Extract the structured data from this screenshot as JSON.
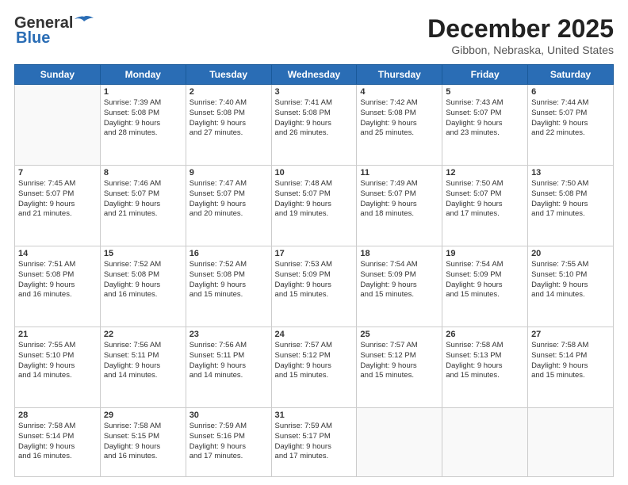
{
  "header": {
    "logo_line1": "General",
    "logo_line2": "Blue",
    "month_title": "December 2025",
    "location": "Gibbon, Nebraska, United States"
  },
  "weekdays": [
    "Sunday",
    "Monday",
    "Tuesday",
    "Wednesday",
    "Thursday",
    "Friday",
    "Saturday"
  ],
  "weeks": [
    [
      {
        "day": "",
        "info": ""
      },
      {
        "day": "1",
        "info": "Sunrise: 7:39 AM\nSunset: 5:08 PM\nDaylight: 9 hours\nand 28 minutes."
      },
      {
        "day": "2",
        "info": "Sunrise: 7:40 AM\nSunset: 5:08 PM\nDaylight: 9 hours\nand 27 minutes."
      },
      {
        "day": "3",
        "info": "Sunrise: 7:41 AM\nSunset: 5:08 PM\nDaylight: 9 hours\nand 26 minutes."
      },
      {
        "day": "4",
        "info": "Sunrise: 7:42 AM\nSunset: 5:08 PM\nDaylight: 9 hours\nand 25 minutes."
      },
      {
        "day": "5",
        "info": "Sunrise: 7:43 AM\nSunset: 5:07 PM\nDaylight: 9 hours\nand 23 minutes."
      },
      {
        "day": "6",
        "info": "Sunrise: 7:44 AM\nSunset: 5:07 PM\nDaylight: 9 hours\nand 22 minutes."
      }
    ],
    [
      {
        "day": "7",
        "info": "Sunrise: 7:45 AM\nSunset: 5:07 PM\nDaylight: 9 hours\nand 21 minutes."
      },
      {
        "day": "8",
        "info": "Sunrise: 7:46 AM\nSunset: 5:07 PM\nDaylight: 9 hours\nand 21 minutes."
      },
      {
        "day": "9",
        "info": "Sunrise: 7:47 AM\nSunset: 5:07 PM\nDaylight: 9 hours\nand 20 minutes."
      },
      {
        "day": "10",
        "info": "Sunrise: 7:48 AM\nSunset: 5:07 PM\nDaylight: 9 hours\nand 19 minutes."
      },
      {
        "day": "11",
        "info": "Sunrise: 7:49 AM\nSunset: 5:07 PM\nDaylight: 9 hours\nand 18 minutes."
      },
      {
        "day": "12",
        "info": "Sunrise: 7:50 AM\nSunset: 5:07 PM\nDaylight: 9 hours\nand 17 minutes."
      },
      {
        "day": "13",
        "info": "Sunrise: 7:50 AM\nSunset: 5:08 PM\nDaylight: 9 hours\nand 17 minutes."
      }
    ],
    [
      {
        "day": "14",
        "info": "Sunrise: 7:51 AM\nSunset: 5:08 PM\nDaylight: 9 hours\nand 16 minutes."
      },
      {
        "day": "15",
        "info": "Sunrise: 7:52 AM\nSunset: 5:08 PM\nDaylight: 9 hours\nand 16 minutes."
      },
      {
        "day": "16",
        "info": "Sunrise: 7:52 AM\nSunset: 5:08 PM\nDaylight: 9 hours\nand 15 minutes."
      },
      {
        "day": "17",
        "info": "Sunrise: 7:53 AM\nSunset: 5:09 PM\nDaylight: 9 hours\nand 15 minutes."
      },
      {
        "day": "18",
        "info": "Sunrise: 7:54 AM\nSunset: 5:09 PM\nDaylight: 9 hours\nand 15 minutes."
      },
      {
        "day": "19",
        "info": "Sunrise: 7:54 AM\nSunset: 5:09 PM\nDaylight: 9 hours\nand 15 minutes."
      },
      {
        "day": "20",
        "info": "Sunrise: 7:55 AM\nSunset: 5:10 PM\nDaylight: 9 hours\nand 14 minutes."
      }
    ],
    [
      {
        "day": "21",
        "info": "Sunrise: 7:55 AM\nSunset: 5:10 PM\nDaylight: 9 hours\nand 14 minutes."
      },
      {
        "day": "22",
        "info": "Sunrise: 7:56 AM\nSunset: 5:11 PM\nDaylight: 9 hours\nand 14 minutes."
      },
      {
        "day": "23",
        "info": "Sunrise: 7:56 AM\nSunset: 5:11 PM\nDaylight: 9 hours\nand 14 minutes."
      },
      {
        "day": "24",
        "info": "Sunrise: 7:57 AM\nSunset: 5:12 PM\nDaylight: 9 hours\nand 15 minutes."
      },
      {
        "day": "25",
        "info": "Sunrise: 7:57 AM\nSunset: 5:12 PM\nDaylight: 9 hours\nand 15 minutes."
      },
      {
        "day": "26",
        "info": "Sunrise: 7:58 AM\nSunset: 5:13 PM\nDaylight: 9 hours\nand 15 minutes."
      },
      {
        "day": "27",
        "info": "Sunrise: 7:58 AM\nSunset: 5:14 PM\nDaylight: 9 hours\nand 15 minutes."
      }
    ],
    [
      {
        "day": "28",
        "info": "Sunrise: 7:58 AM\nSunset: 5:14 PM\nDaylight: 9 hours\nand 16 minutes."
      },
      {
        "day": "29",
        "info": "Sunrise: 7:58 AM\nSunset: 5:15 PM\nDaylight: 9 hours\nand 16 minutes."
      },
      {
        "day": "30",
        "info": "Sunrise: 7:59 AM\nSunset: 5:16 PM\nDaylight: 9 hours\nand 17 minutes."
      },
      {
        "day": "31",
        "info": "Sunrise: 7:59 AM\nSunset: 5:17 PM\nDaylight: 9 hours\nand 17 minutes."
      },
      {
        "day": "",
        "info": ""
      },
      {
        "day": "",
        "info": ""
      },
      {
        "day": "",
        "info": ""
      }
    ]
  ]
}
